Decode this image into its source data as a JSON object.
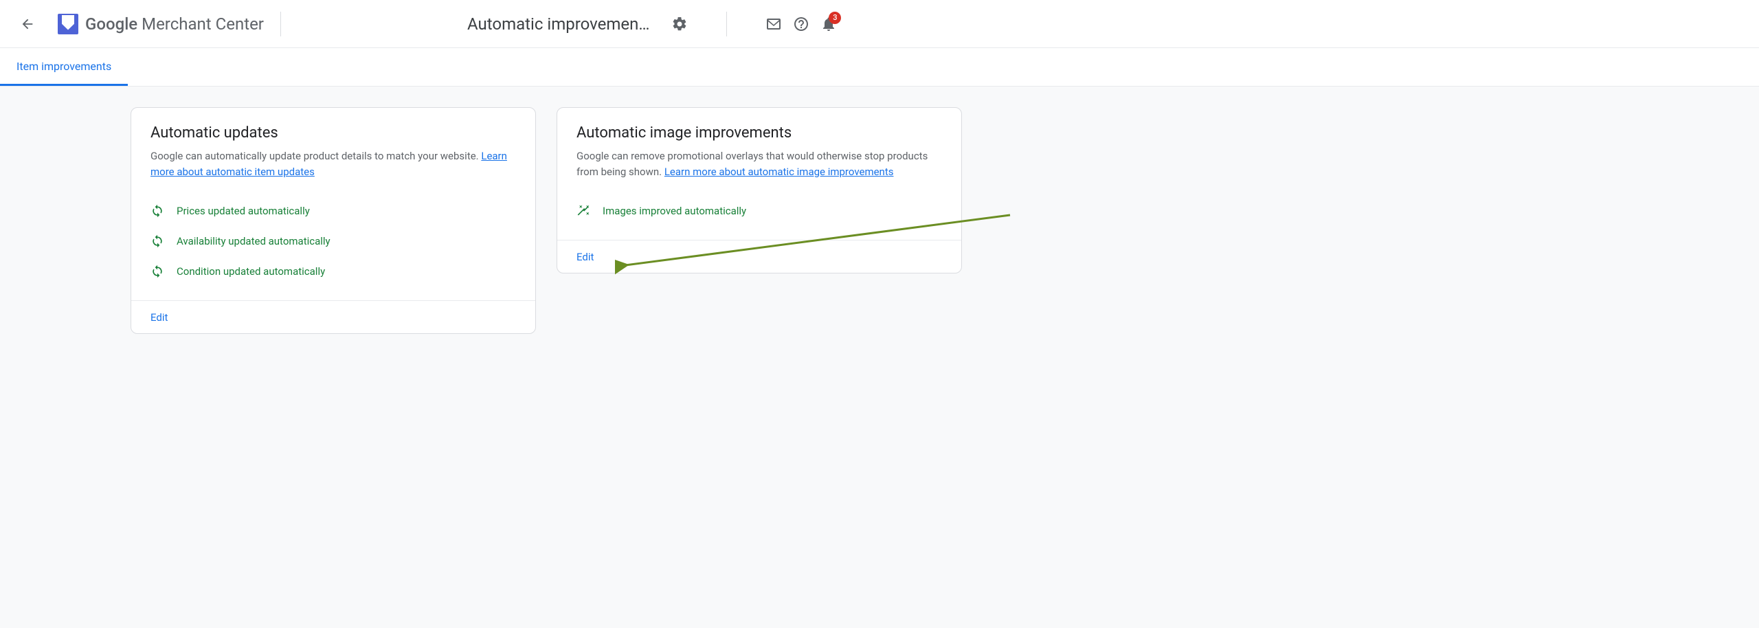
{
  "header": {
    "google": "Google",
    "product": " Merchant Center",
    "page_title": "Automatic improvemen…",
    "notification_count": "3"
  },
  "tabs": {
    "item_improvements": "Item improvements"
  },
  "card1": {
    "title": "Automatic updates",
    "desc_prefix": "Google can automatically update product details to match your website. ",
    "learn_more": "Learn more about automatic item updates",
    "statuses": [
      "Prices updated automatically",
      "Availability updated automatically",
      "Condition updated automatically"
    ],
    "edit": "Edit"
  },
  "card2": {
    "title": "Automatic image improvements",
    "desc_prefix": "Google can remove promotional overlays that would otherwise stop products from being shown. ",
    "learn_more": "Learn more about automatic image improvements",
    "status": "Images improved automatically",
    "edit": "Edit"
  }
}
